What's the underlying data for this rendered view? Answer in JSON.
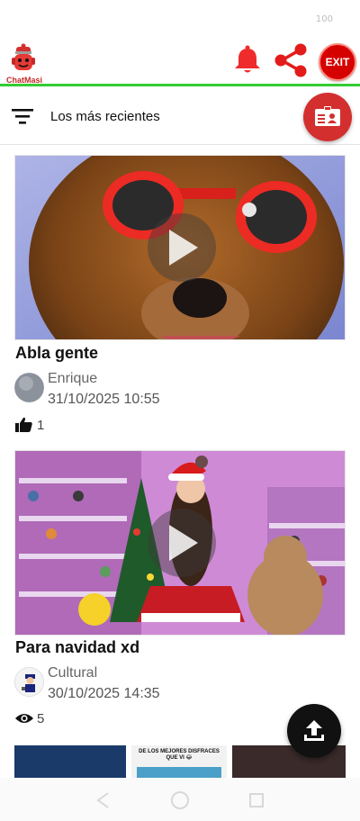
{
  "status_bar": {
    "battery": "100"
  },
  "header": {
    "logo_text": "ChatMasi",
    "exit_label": "EXIT",
    "accent": "#33cc33",
    "icons": [
      "bell-icon",
      "share-icon",
      "exit-icon"
    ]
  },
  "toolbar": {
    "sort_label": "Los más recientes"
  },
  "posts": [
    {
      "title": "Abla gente",
      "author": "Enrique",
      "date": "31/10/2025 10:55",
      "stat_icon": "thumbs-up-icon",
      "stat_count": "1"
    },
    {
      "title": "Para navidad xd",
      "author": "Cultural",
      "date": "30/10/2025 14:35",
      "stat_icon": "eye-icon",
      "stat_count": "5"
    }
  ],
  "partial_thumbnail": {
    "caption": "DE LOS MEJORES DISFRACES QUE VI 😂"
  },
  "colors": {
    "brand_red": "#d32f2f",
    "exit_red": "#d50000",
    "fab": "#111111"
  }
}
